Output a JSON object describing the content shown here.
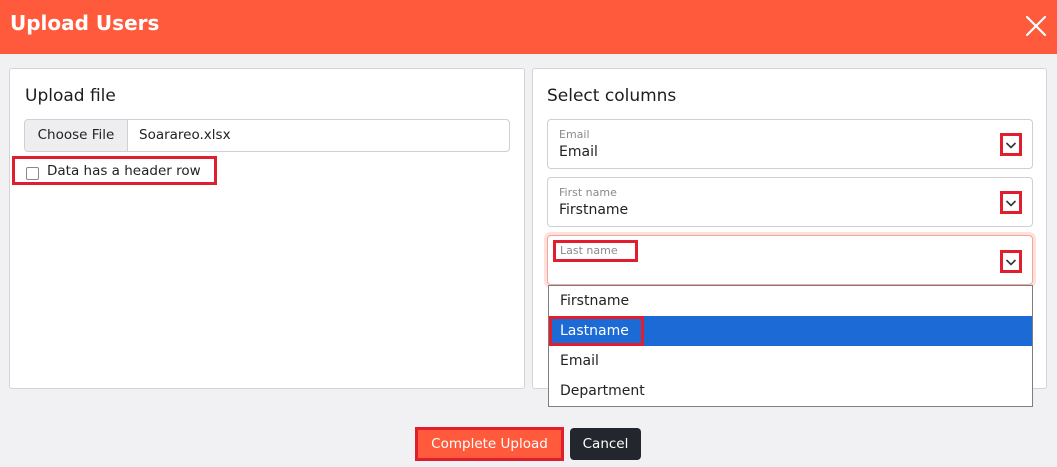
{
  "dialog": {
    "title": "Upload Users",
    "close_icon": "close-icon"
  },
  "upload_file": {
    "heading": "Upload file",
    "choose_file_label": "Choose File",
    "file_name": "Soarareo.xlsx",
    "header_row_label": "Data has a header row",
    "header_row_checked": false
  },
  "select_columns": {
    "heading": "Select columns",
    "fields": [
      {
        "label": "Email",
        "value": "Email"
      },
      {
        "label": "First name",
        "value": "Firstname"
      },
      {
        "label": "Last name",
        "value": ""
      }
    ],
    "chevron_icon": "chevron-down-icon",
    "dropdown_options": [
      "Firstname",
      "Lastname",
      "Email",
      "Department"
    ],
    "selected_option": "Lastname"
  },
  "footer": {
    "complete_label": "Complete Upload",
    "cancel_label": "Cancel"
  },
  "colors": {
    "brand": "#ff5a3c",
    "highlight": "#e01e2d",
    "selected": "#1c6ad6",
    "cancel": "#24262e"
  }
}
